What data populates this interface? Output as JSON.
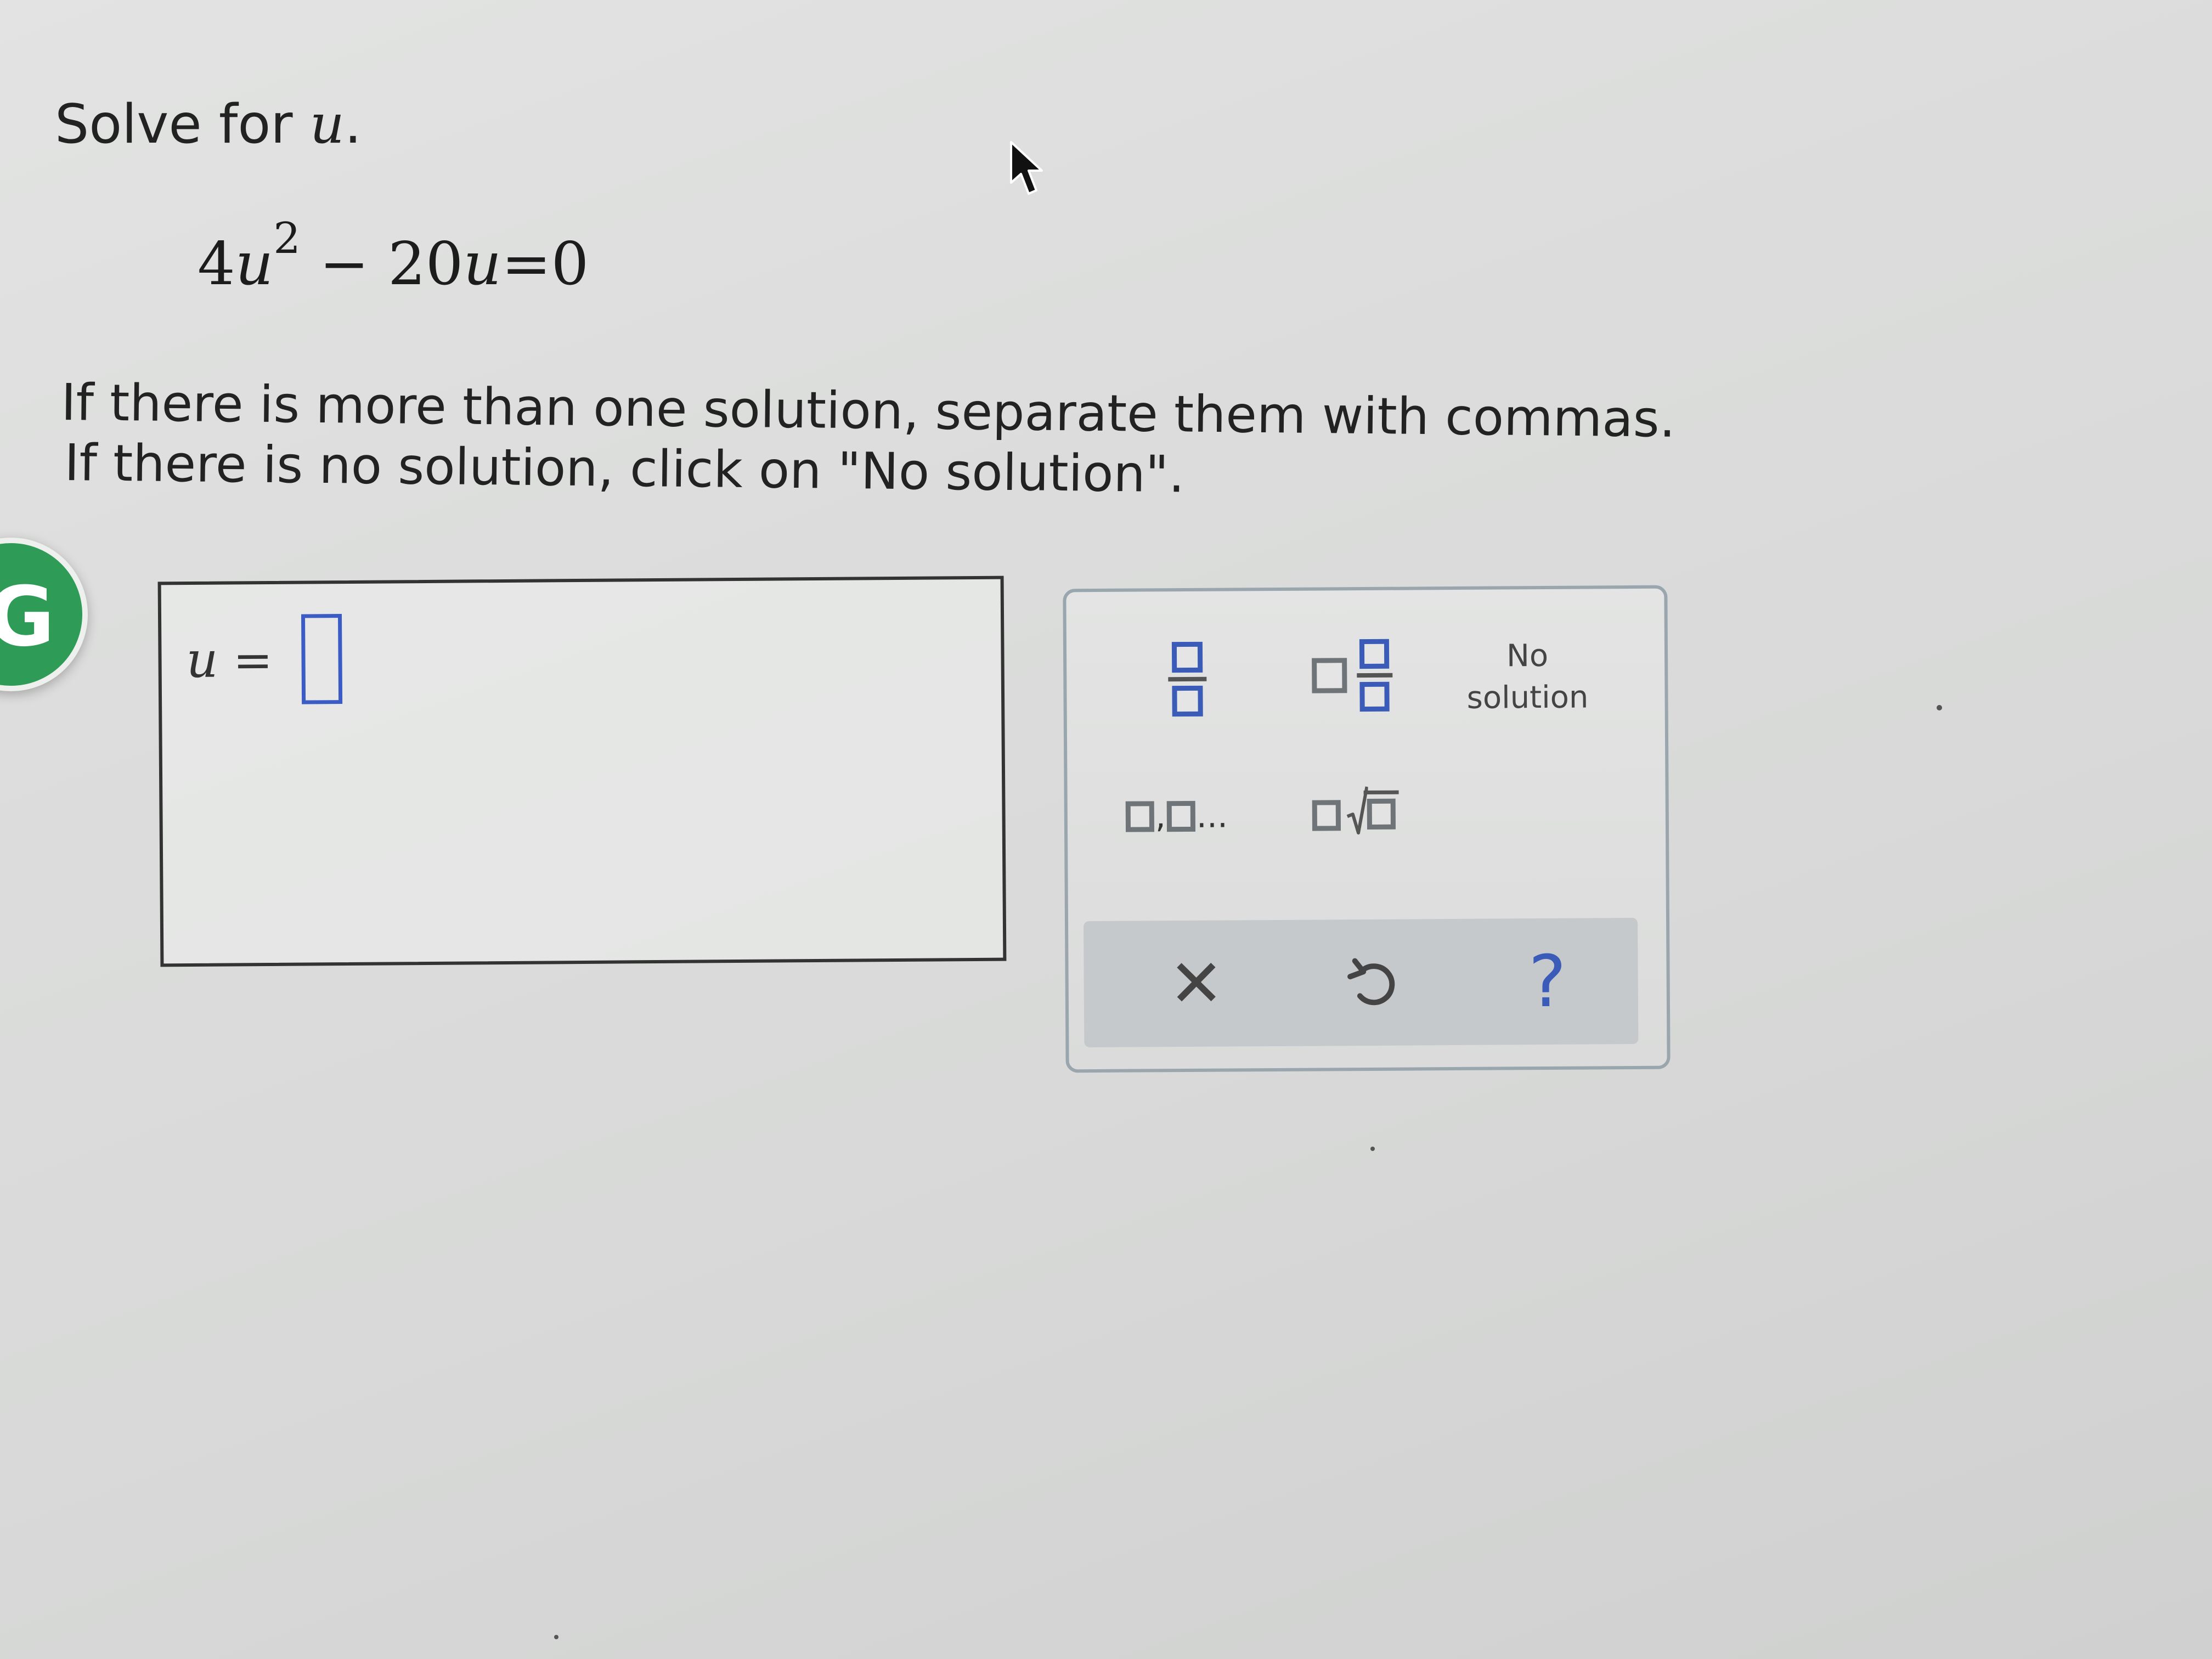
{
  "problem": {
    "prompt_prefix": "Solve for ",
    "prompt_variable": "u",
    "prompt_suffix": ".",
    "equation": {
      "coef_a": "4",
      "variable": "u",
      "exponent": "2",
      "minus": " − ",
      "coef_b": "20",
      "equals": "=",
      "rhs": "0"
    },
    "instruction_line1": "If there is more than one solution, separate them with commas.",
    "instruction_line2": "If there is no solution, click on \"No solution\"."
  },
  "answer": {
    "variable": "u",
    "equals": " = ",
    "value": ""
  },
  "keypad": {
    "no_solution_line1": "No",
    "no_solution_line2": "solution",
    "list_separator": ",",
    "list_ellipsis": "...",
    "clear_symbol": "✕",
    "help_symbol": "?"
  },
  "icons": {
    "fraction": "fraction-icon",
    "mixed_number": "mixed-number-icon",
    "list": "list-icon",
    "nth_root": "nth-root-icon",
    "clear": "close-icon",
    "undo": "undo-icon",
    "help": "help-icon",
    "grammarly": "grammarly-icon",
    "cursor": "mouse-pointer-icon"
  },
  "colors": {
    "accent_blue": "#3a5cb8",
    "grammarly_green": "#2e9b57",
    "action_bar": "#c5c9cc"
  }
}
